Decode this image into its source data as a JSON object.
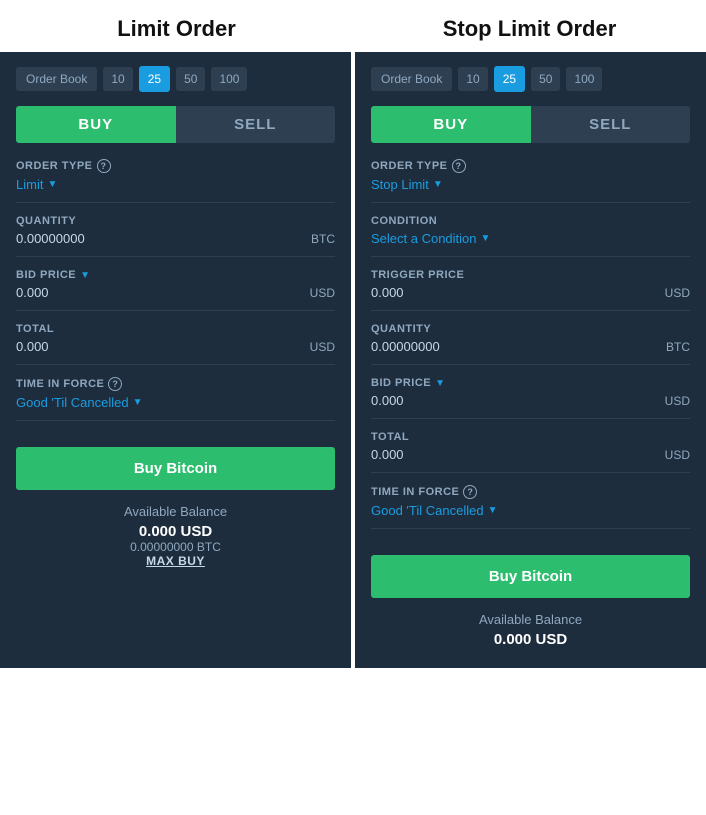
{
  "titles": {
    "limit": "Limit Order",
    "stop_limit": "Stop Limit Order"
  },
  "orderbook": {
    "label": "Order Book",
    "options": [
      "10",
      "25",
      "50",
      "100"
    ],
    "active": "25"
  },
  "limit_panel": {
    "buy_label": "BUY",
    "sell_label": "SELL",
    "order_type_label": "ORDER TYPE",
    "order_type_value": "Limit",
    "quantity_label": "QUANTITY",
    "quantity_value": "0.00000000",
    "quantity_unit": "BTC",
    "bid_price_label": "BID PRICE",
    "bid_price_value": "0.000",
    "bid_price_unit": "USD",
    "total_label": "TOTAL",
    "total_value": "0.000",
    "total_unit": "USD",
    "time_in_force_label": "TIME IN FORCE",
    "time_in_force_value": "Good 'Til Cancelled",
    "buy_bitcoin_label": "Buy Bitcoin",
    "available_balance_label": "Available Balance",
    "usd_balance": "0.000  USD",
    "btc_balance": "0.00000000 BTC",
    "max_buy_label": "MAX BUY"
  },
  "stop_limit_panel": {
    "buy_label": "BUY",
    "sell_label": "SELL",
    "order_type_label": "ORDER TYPE",
    "order_type_value": "Stop Limit",
    "condition_label": "CONDITION",
    "condition_value": "Select a Condition",
    "trigger_price_label": "TRIGGER PRICE",
    "trigger_price_value": "0.000",
    "trigger_price_unit": "USD",
    "quantity_label": "QUANTITY",
    "quantity_value": "0.00000000",
    "quantity_unit": "BTC",
    "bid_price_label": "BID PRICE",
    "bid_price_value": "0.000",
    "bid_price_unit": "USD",
    "total_label": "TOTAL",
    "total_value": "0.000",
    "total_unit": "USD",
    "time_in_force_label": "TIME IN FORCE",
    "time_in_force_value": "Good 'Til Cancelled",
    "buy_bitcoin_label": "Buy Bitcoin",
    "available_balance_label": "Available Balance",
    "usd_balance": "0.000 USD"
  }
}
